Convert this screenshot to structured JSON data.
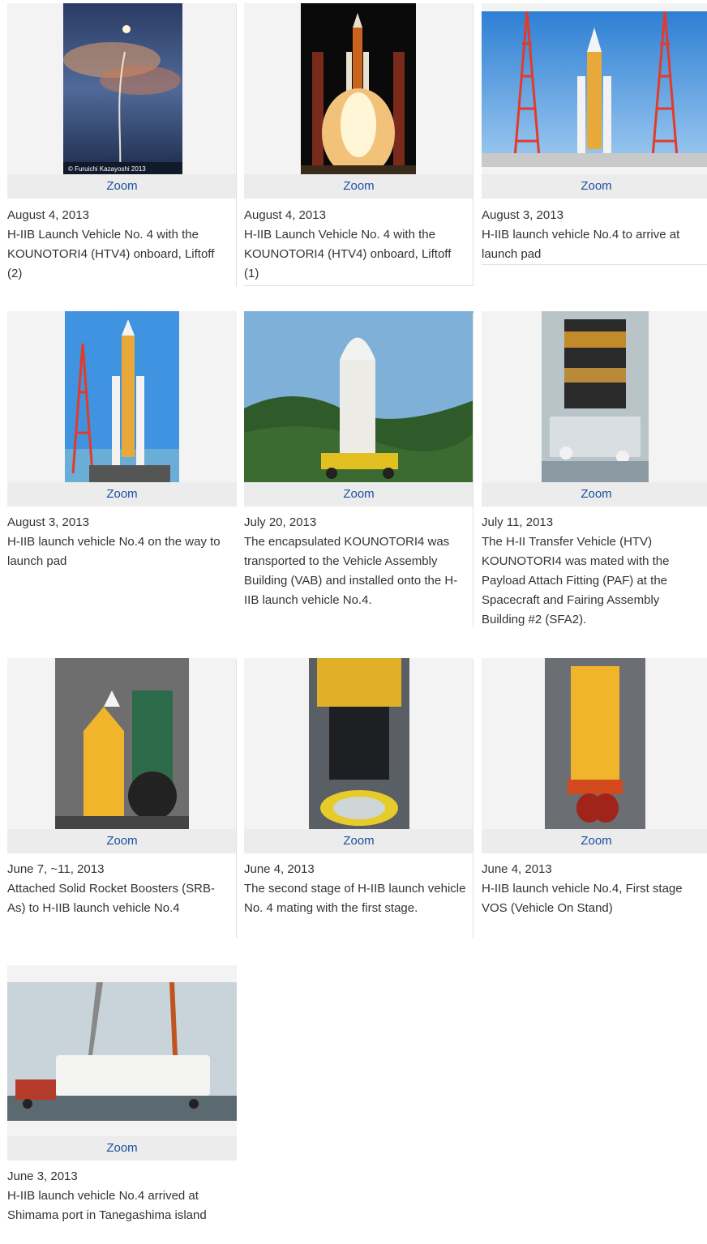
{
  "zoom_label": "Zoom",
  "items": [
    {
      "date": "August 4, 2013",
      "caption": "H-IIB Launch Vehicle No. 4 with the KOUNOTORI4 (HTV4) onboard, Liftoff (2)",
      "credit": "© Furuichi Kazayoshi 2013"
    },
    {
      "date": "August 4, 2013",
      "caption": "H-IIB Launch Vehicle No. 4 with the KOUNOTORI4 (HTV4) onboard, Liftoff (1)"
    },
    {
      "date": "August 3, 2013",
      "caption": "H-IIB launch vehicle No.4 to arrive at launch pad"
    },
    {
      "date": "August 3, 2013",
      "caption": "H-IIB launch vehicle No.4 on the way to launch pad"
    },
    {
      "date": "July 20, 2013",
      "caption": "The encapsulated KOUNOTORI4 was transported to the Vehicle Assembly Building (VAB) and installed onto the H-IIB launch vehicle No.4."
    },
    {
      "date": "July 11, 2013",
      "caption": "The H-II Transfer Vehicle (HTV) KOUNOTORI4 was mated with the Payload Attach Fitting (PAF) at the Spacecraft and Fairing Assembly Building #2 (SFA2)."
    },
    {
      "date": "June 7, ~11, 2013",
      "caption": "Attached Solid Rocket Boosters (SRB-As) to H-IIB launch vehicle No.4"
    },
    {
      "date": "June 4, 2013",
      "caption": "The second stage of H-IIB launch vehicle No. 4 mating with the first stage."
    },
    {
      "date": "June 4, 2013",
      "caption": "H-IIB launch vehicle No.4, First stage VOS (Vehicle On Stand)"
    },
    {
      "date": "June 3, 2013",
      "caption": "H-IIB launch vehicle No.4 arrived at Shimama port in Tanegashima island"
    }
  ]
}
